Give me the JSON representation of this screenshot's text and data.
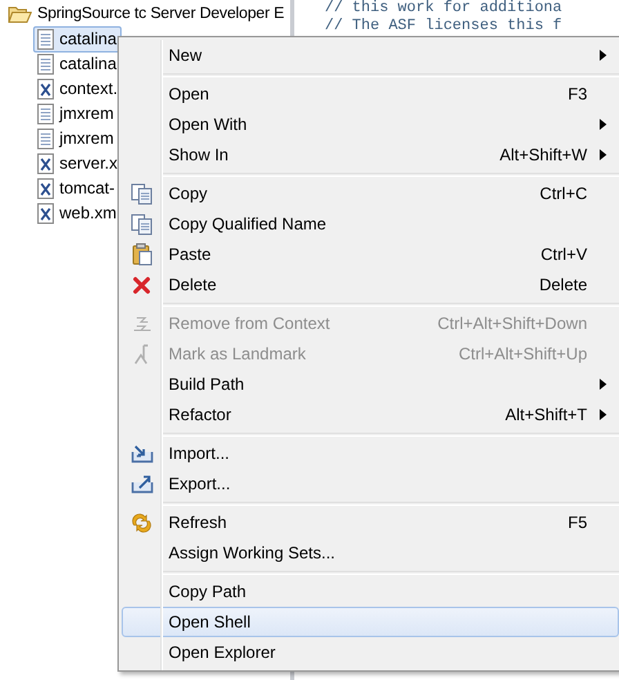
{
  "tree": {
    "root": {
      "label": "SpringSource tc Server Developer E",
      "expanded": true
    },
    "children": [
      {
        "label": "catalina",
        "kind": "text",
        "selected": true
      },
      {
        "label": "catalina",
        "kind": "text",
        "selected": false
      },
      {
        "label": "context.",
        "kind": "xml",
        "selected": false
      },
      {
        "label": "jmxrem",
        "kind": "text",
        "selected": false
      },
      {
        "label": "jmxrem",
        "kind": "text",
        "selected": false
      },
      {
        "label": "server.x",
        "kind": "xml",
        "selected": false
      },
      {
        "label": "tomcat-",
        "kind": "xml",
        "selected": false
      },
      {
        "label": "web.xm",
        "kind": "xml",
        "selected": false
      }
    ]
  },
  "editor": {
    "lines": [
      "// this work for additiona",
      "// The ASF licenses this f"
    ]
  },
  "context_menu": [
    {
      "kind": "item",
      "label": "New",
      "submenu": true,
      "disabled": false,
      "selected": false
    },
    {
      "kind": "separator"
    },
    {
      "kind": "item",
      "label": "Open",
      "shortcut": "F3",
      "submenu": false,
      "disabled": false,
      "selected": false
    },
    {
      "kind": "item",
      "label": "Open With",
      "submenu": true,
      "disabled": false,
      "selected": false
    },
    {
      "kind": "item",
      "label": "Show In",
      "shortcut": "Alt+Shift+W",
      "submenu": true,
      "disabled": false,
      "selected": false
    },
    {
      "kind": "separator"
    },
    {
      "kind": "item",
      "label": "Copy",
      "shortcut": "Ctrl+C",
      "submenu": false,
      "disabled": false,
      "selected": false
    },
    {
      "kind": "item",
      "label": "Copy Qualified Name",
      "submenu": false,
      "disabled": false,
      "selected": false
    },
    {
      "kind": "item",
      "label": "Paste",
      "shortcut": "Ctrl+V",
      "submenu": false,
      "disabled": false,
      "selected": false
    },
    {
      "kind": "item",
      "label": "Delete",
      "shortcut": "Delete",
      "submenu": false,
      "disabled": false,
      "selected": false
    },
    {
      "kind": "separator"
    },
    {
      "kind": "item",
      "label": "Remove from Context",
      "shortcut": "Ctrl+Alt+Shift+Down",
      "submenu": false,
      "disabled": true,
      "selected": false
    },
    {
      "kind": "item",
      "label": "Mark as Landmark",
      "shortcut": "Ctrl+Alt+Shift+Up",
      "submenu": false,
      "disabled": true,
      "selected": false
    },
    {
      "kind": "item",
      "label": "Build Path",
      "submenu": true,
      "disabled": false,
      "selected": false
    },
    {
      "kind": "item",
      "label": "Refactor",
      "shortcut": "Alt+Shift+T",
      "submenu": true,
      "disabled": false,
      "selected": false
    },
    {
      "kind": "separator"
    },
    {
      "kind": "item",
      "label": "Import...",
      "submenu": false,
      "disabled": false,
      "selected": false
    },
    {
      "kind": "item",
      "label": "Export...",
      "submenu": false,
      "disabled": false,
      "selected": false
    },
    {
      "kind": "separator"
    },
    {
      "kind": "item",
      "label": "Refresh",
      "shortcut": "F5",
      "submenu": false,
      "disabled": false,
      "selected": false
    },
    {
      "kind": "item",
      "label": "Assign Working Sets...",
      "submenu": false,
      "disabled": false,
      "selected": false
    },
    {
      "kind": "separator"
    },
    {
      "kind": "item",
      "label": "Copy Path",
      "submenu": false,
      "disabled": false,
      "selected": false
    },
    {
      "kind": "item",
      "label": "Open Shell",
      "submenu": false,
      "disabled": false,
      "selected": true
    },
    {
      "kind": "item",
      "label": "Open Explorer",
      "submenu": false,
      "disabled": false,
      "selected": false
    }
  ]
}
